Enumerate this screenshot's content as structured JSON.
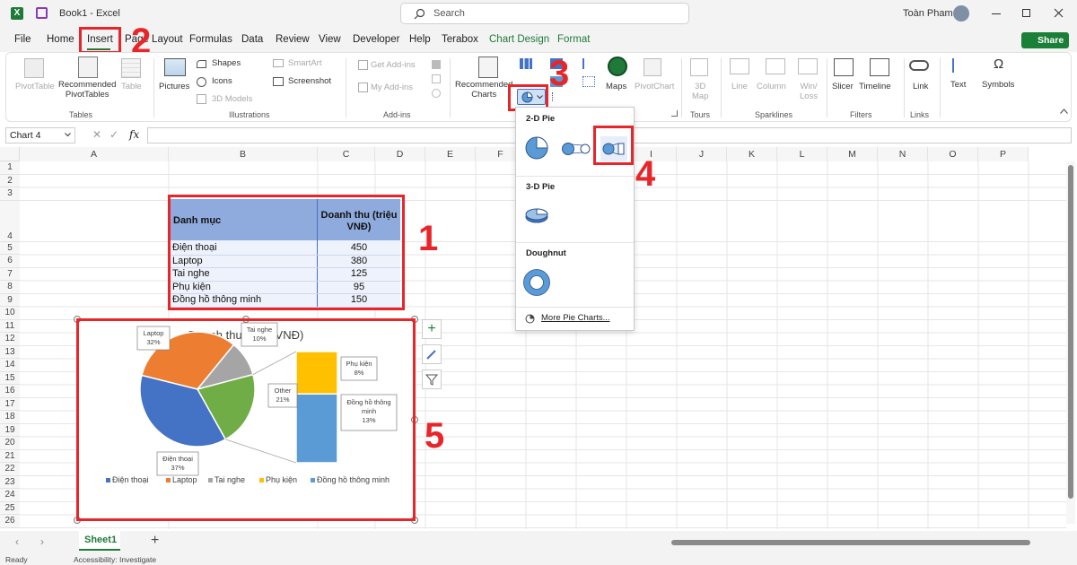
{
  "titlebar": {
    "doc_title": "Book1  -  Excel",
    "search_placeholder": "Search",
    "user_name": "Toàn Pham",
    "share_label": "Share"
  },
  "tabs": [
    {
      "label": "File"
    },
    {
      "label": "Home"
    },
    {
      "label": "Insert"
    },
    {
      "label": "Page Layout"
    },
    {
      "label": "Formulas"
    },
    {
      "label": "Data"
    },
    {
      "label": "Review"
    },
    {
      "label": "View"
    },
    {
      "label": "Developer"
    },
    {
      "label": "Help"
    },
    {
      "label": "Terabox"
    },
    {
      "label": "Chart Design"
    },
    {
      "label": "Format"
    }
  ],
  "ribbon": {
    "pivottable": "PivotTable",
    "recommended_pivot": "Recommended\nPivotTables",
    "table": "Table",
    "pictures": "Pictures",
    "shapes": "Shapes",
    "icons": "Icons",
    "models3d": "3D Models",
    "smartart": "SmartArt",
    "screenshot": "Screenshot",
    "get_addins": "Get Add-ins",
    "my_addins": "My Add-ins",
    "recommended_charts": "Recommended\nCharts",
    "maps": "Maps",
    "pivotchart": "PivotChart",
    "map3d": "3D\nMap",
    "line": "Line",
    "column": "Column",
    "winloss": "Win/\nLoss",
    "slicer": "Slicer",
    "timeline": "Timeline",
    "link": "Link",
    "text": "Text",
    "symbols": "Symbols",
    "groups": {
      "tables": "Tables",
      "illustrations": "Illustrations",
      "addins": "Add-ins",
      "tours": "Tours",
      "sparklines": "Sparklines",
      "filters": "Filters",
      "links": "Links"
    }
  },
  "formula_bar": {
    "name_box": "Chart 4",
    "fx": "fx",
    "content": ""
  },
  "columns": [
    "A",
    "B",
    "C",
    "D",
    "E",
    "F",
    "G",
    "H",
    "I",
    "J",
    "K",
    "L",
    "M",
    "N",
    "O",
    "P"
  ],
  "rows": [
    "1",
    "2",
    "3",
    "4",
    "5",
    "6",
    "7",
    "8",
    "9",
    "10",
    "11",
    "12",
    "13",
    "14",
    "15",
    "16",
    "17",
    "18",
    "19",
    "20",
    "21",
    "22",
    "23",
    "24",
    "25",
    "26"
  ],
  "table": {
    "header_col1": "Danh mục",
    "header_col2": "Doanh thu (triệu VNĐ)",
    "rows": [
      {
        "label": "Điện thoại",
        "value": "450"
      },
      {
        "label": "Laptop",
        "value": "380"
      },
      {
        "label": "Tai nghe",
        "value": "125"
      },
      {
        "label": "Phụ kiện",
        "value": "95"
      },
      {
        "label": "Đồng hồ thông minh",
        "value": "150"
      }
    ]
  },
  "pie_menu": {
    "section_2d": "2-D Pie",
    "section_3d": "3-D Pie",
    "section_doughnut": "Doughnut",
    "more": "More Pie Charts..."
  },
  "annotations": [
    "1",
    "2",
    "3",
    "4",
    "5"
  ],
  "chart_data": {
    "type": "pie",
    "subtype": "bar-of-pie",
    "title": "Doanh thu (triệu VNĐ)",
    "categories": [
      "Điện thoại",
      "Laptop",
      "Tai nghe",
      "Phụ kiện",
      "Đồng hồ thông minh"
    ],
    "values": [
      450,
      380,
      125,
      95,
      150
    ],
    "colors": [
      "#4472c4",
      "#ed7d31",
      "#a5a5a5",
      "#ffc000",
      "#5b9bd5"
    ],
    "other_color": "#70ad47",
    "main_pie": [
      {
        "label": "Laptop",
        "pct": "32%",
        "value": 32
      },
      {
        "label": "Tai nghe",
        "pct": "10%",
        "value": 10
      },
      {
        "label": "Other",
        "pct": "21%",
        "value": 21
      },
      {
        "label": "Điện thoại",
        "pct": "37%",
        "value": 37
      }
    ],
    "secondary_bar": [
      {
        "label": "Phụ kiện",
        "pct": "8%",
        "value": 8
      },
      {
        "label": "Đồng hồ thông minh",
        "pct": "13%",
        "value": 13
      }
    ],
    "legend_position": "bottom"
  },
  "sheet": {
    "tab_name": "Sheet1",
    "status_ready": "Ready",
    "accessibility": "Accessibility: Investigate"
  },
  "colors": {
    "annotation_red": "#e8262a",
    "excel_green": "#1f7a3a",
    "share_green": "#1a7f37"
  }
}
